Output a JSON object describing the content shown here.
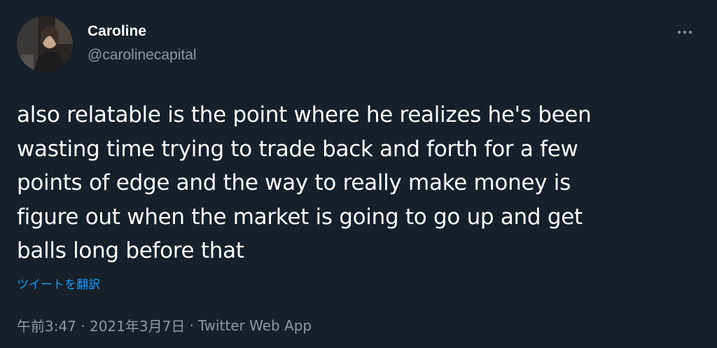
{
  "author": {
    "name": "Caroline",
    "handle": "@carolinecapital"
  },
  "tweet": {
    "text": "also relatable is the point where he realizes he's been\nwasting time trying to trade back and forth for a few\npoints of edge and the way to really make money is\nfigure out when the market is going to go up and get\nballs long before that",
    "translate_label": "ツイートを翻訳",
    "timestamp": "午前3:47 · 2021年3月7日",
    "separator": "·",
    "source": "Twitter Web App"
  },
  "icons": {
    "more": "more-horizontal-icon"
  },
  "colors": {
    "background": "#15202b",
    "text": "#ffffff",
    "secondary_text": "#8b98a5",
    "link": "#1d9bf0"
  }
}
